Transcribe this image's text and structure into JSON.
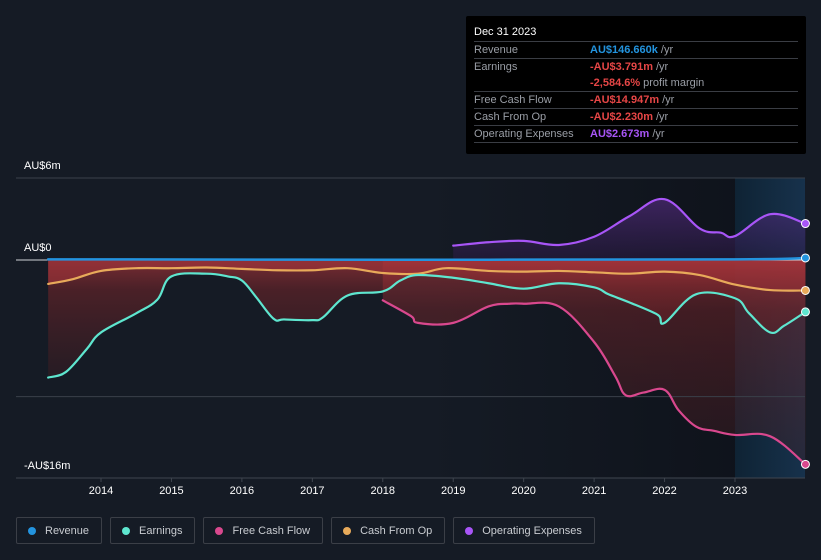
{
  "tooltip": {
    "date": "Dec 31 2023",
    "rows": [
      {
        "label": "Revenue",
        "value": "AU$146.660k",
        "suffix": "/yr",
        "color": "#2394df"
      },
      {
        "label": "Earnings",
        "value": "-AU$3.791m",
        "suffix": "/yr",
        "color": "#e64646"
      },
      {
        "label": "",
        "value": "-2,584.6%",
        "suffix": "profit margin",
        "color": "#e64646"
      },
      {
        "label": "Free Cash Flow",
        "value": "-AU$14.947m",
        "suffix": "/yr",
        "color": "#e64646"
      },
      {
        "label": "Cash From Op",
        "value": "-AU$2.230m",
        "suffix": "/yr",
        "color": "#e64646"
      },
      {
        "label": "Operating Expenses",
        "value": "AU$2.673m",
        "suffix": "/yr",
        "color": "#a855f7"
      }
    ]
  },
  "legend": [
    {
      "label": "Revenue",
      "color": "#2394df"
    },
    {
      "label": "Earnings",
      "color": "#5ee6cf"
    },
    {
      "label": "Free Cash Flow",
      "color": "#d9488e"
    },
    {
      "label": "Cash From Op",
      "color": "#e8aa5a"
    },
    {
      "label": "Operating Expenses",
      "color": "#a855f7"
    }
  ],
  "chart_data": {
    "type": "line",
    "title": "",
    "xlabel": "",
    "ylabel": "",
    "ylim": [
      -16,
      6
    ],
    "xlim": [
      2013.25,
      2024.0
    ],
    "y_tick_labels": [
      {
        "value": 6,
        "label": "AU$6m"
      },
      {
        "value": 0,
        "label": "AU$0"
      },
      {
        "value": -16,
        "label": "-AU$16m"
      }
    ],
    "y_gridlines": [
      6,
      0,
      -10
    ],
    "x_ticks": [
      2014,
      2015,
      2016,
      2017,
      2018,
      2019,
      2020,
      2021,
      2022,
      2023
    ],
    "forecast_shade_start": 2023.0,
    "legend_position": "bottom",
    "series": [
      {
        "name": "Revenue",
        "color": "#2394df",
        "x": [
          2013.25,
          2018,
          2023,
          2024.0
        ],
        "y": [
          0.05,
          0.02,
          0.05,
          0.15
        ]
      },
      {
        "name": "Earnings",
        "color": "#5ee6cf",
        "x": [
          2013.25,
          2013.5,
          2013.8,
          2014.0,
          2014.5,
          2014.8,
          2015.0,
          2015.5,
          2015.8,
          2016.0,
          2016.2,
          2016.45,
          2016.6,
          2017.0,
          2017.15,
          2017.5,
          2018.0,
          2018.25,
          2018.5,
          2019.0,
          2019.5,
          2020.0,
          2020.5,
          2021.0,
          2021.2,
          2021.5,
          2021.9,
          2022.0,
          2022.45,
          2023.0,
          2023.2,
          2023.5,
          2023.7,
          2024.0
        ],
        "y": [
          -8.6,
          -8.2,
          -6.5,
          -5.3,
          -3.9,
          -2.9,
          -1.2,
          -1.0,
          -1.2,
          -1.5,
          -2.7,
          -4.3,
          -4.35,
          -4.4,
          -4.2,
          -2.6,
          -2.3,
          -1.5,
          -1.1,
          -1.3,
          -1.7,
          -2.1,
          -1.7,
          -2.0,
          -2.5,
          -3.1,
          -4.0,
          -4.6,
          -2.5,
          -2.8,
          -3.9,
          -5.3,
          -4.8,
          -3.8
        ]
      },
      {
        "name": "Free Cash Flow",
        "color": "#d9488e",
        "x": [
          2018.0,
          2018.4,
          2018.5,
          2019.0,
          2019.5,
          2019.8,
          2020.0,
          2020.5,
          2021.0,
          2021.3,
          2021.45,
          2021.7,
          2022.0,
          2022.2,
          2022.45,
          2022.7,
          2023.0,
          2023.5,
          2024.0
        ],
        "y": [
          -2.95,
          -4.1,
          -4.6,
          -4.6,
          -3.4,
          -3.2,
          -3.2,
          -3.4,
          -6.0,
          -8.5,
          -9.9,
          -9.7,
          -9.5,
          -11.0,
          -12.2,
          -12.5,
          -12.8,
          -12.9,
          -14.95
        ]
      },
      {
        "name": "Cash From Op",
        "color": "#e8aa5a",
        "x": [
          2013.25,
          2013.6,
          2014.0,
          2014.5,
          2015.0,
          2015.5,
          2016.0,
          2016.5,
          2017.0,
          2017.5,
          2018.0,
          2018.5,
          2018.9,
          2019.5,
          2020.0,
          2020.5,
          2021.0,
          2021.5,
          2022.0,
          2022.5,
          2023.0,
          2023.5,
          2024.0
        ],
        "y": [
          -1.75,
          -1.4,
          -0.8,
          -0.6,
          -0.6,
          -0.55,
          -0.65,
          -0.75,
          -0.75,
          -0.6,
          -0.95,
          -1.0,
          -0.6,
          -0.8,
          -0.85,
          -0.8,
          -0.9,
          -1.0,
          -0.85,
          -1.1,
          -1.8,
          -2.2,
          -2.23
        ]
      },
      {
        "name": "Operating Expenses",
        "color": "#a855f7",
        "x": [
          2019.0,
          2019.5,
          2020.0,
          2020.5,
          2021.0,
          2021.5,
          2022.0,
          2022.5,
          2022.8,
          2023.0,
          2023.5,
          2024.0
        ],
        "y": [
          1.05,
          1.3,
          1.4,
          1.1,
          1.7,
          3.2,
          4.45,
          2.3,
          2.0,
          1.75,
          3.35,
          2.67
        ]
      }
    ]
  }
}
